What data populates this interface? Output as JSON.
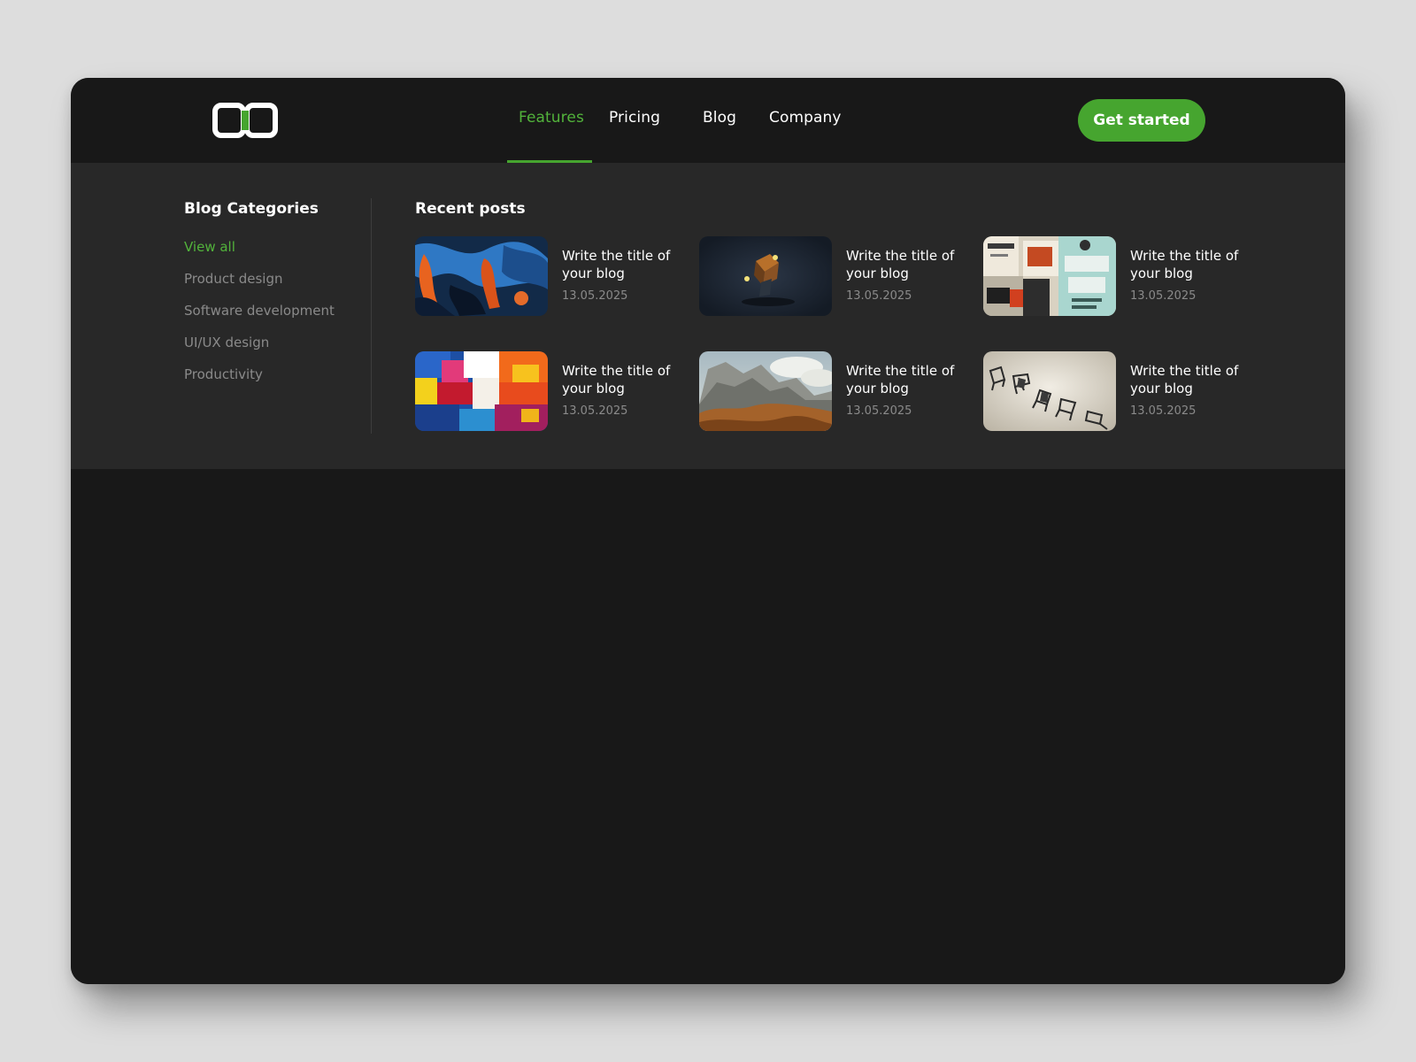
{
  "nav": {
    "items": [
      {
        "label": "Features",
        "active": true
      },
      {
        "label": "Pricing"
      },
      {
        "label": "Blog"
      },
      {
        "label": "Company"
      }
    ],
    "cta_label": "Get started"
  },
  "categories": {
    "title": "Blog Categories",
    "items": [
      {
        "label": "View all",
        "active": true
      },
      {
        "label": "Product design"
      },
      {
        "label": "Software development"
      },
      {
        "label": "UI/UX design"
      },
      {
        "label": "Productivity"
      }
    ]
  },
  "recent": {
    "title": "Recent posts",
    "posts": [
      {
        "title": "Write the title of your blog",
        "date": "13.05.2025",
        "image": "abstract-paint-blue-orange"
      },
      {
        "title": "Write the title of your blog",
        "date": "13.05.2025",
        "image": "floating-cube-dark"
      },
      {
        "title": "Write the title of your blog",
        "date": "13.05.2025",
        "image": "poster-collage-wall"
      },
      {
        "title": "Write the title of your blog",
        "date": "13.05.2025",
        "image": "colorful-abstract-painting"
      },
      {
        "title": "Write the title of your blog",
        "date": "13.05.2025",
        "image": "mountain-landscape-painting"
      },
      {
        "title": "Write the title of your blog",
        "date": "13.05.2025",
        "image": "flying-chairs"
      }
    ]
  },
  "colors": {
    "accent": "#46a52f",
    "background": "#181818",
    "panel": "#282828",
    "muted_text": "#8a8a8a"
  }
}
